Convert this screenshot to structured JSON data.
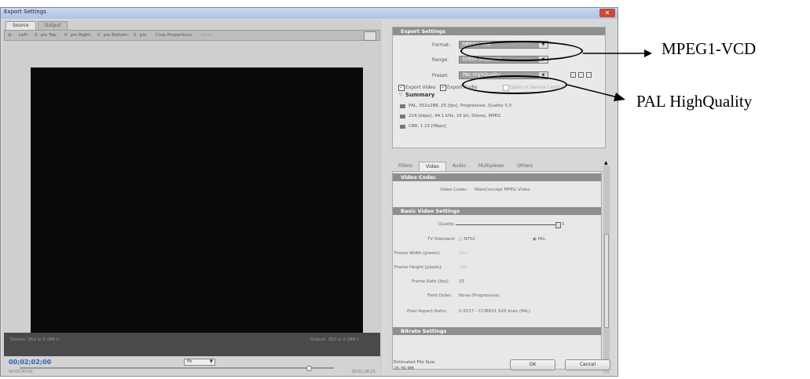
{
  "window": {
    "title": "Export Settings",
    "close_glyph": "✕"
  },
  "left": {
    "tabs": [
      "Source",
      "Output"
    ],
    "crop": {
      "left": "Left:",
      "top": "pix Top:",
      "right": "pix Right:",
      "bottom": "pix Bottom:",
      "pix": "pix",
      "proportions": "Crop Proportions:",
      "proportions_value": "None"
    },
    "source_info": "Source: 352 w X 288 h",
    "output_info": "Output: 352 w X 288 h",
    "timecode": "00;02;02;00",
    "fit": "Fit",
    "time_start": "00;00;00;00",
    "time_end": "00;02;28;21",
    "playhead_fraction": 0.92
  },
  "export": {
    "header": "Export Settings",
    "format_label": "Format:",
    "format_value": "MPEG1-VCD",
    "range_label": "Range:",
    "range_value": "Entire Sequence",
    "preset_label": "Preset:",
    "preset_value": "PAL HighQuality",
    "export_video": "Export Video",
    "export_audio": "Export Audio",
    "open_in_device": "Open in Device Central",
    "summary_title": "Summary",
    "summary_video": "PAL, 352x288, 25 [fps], Progressive, Quality 5.0",
    "summary_audio": "224 [kbps], 44.1 kHz, 16 bit, Stereo, MPEG",
    "summary_bitrate": "CBR, 1.15 [Mbps]"
  },
  "tabs2": [
    "Filters",
    "Video",
    "Audio",
    "Multiplexer",
    "Others"
  ],
  "video": {
    "codec_header": "Video Codec",
    "codec_label": "Video Codec:",
    "codec_value": "MainConcept MPEG Video",
    "basic_header": "Basic Video Settings",
    "quality_label": "Quality:",
    "quality_value": "5",
    "quality_fraction": 1.0,
    "tv_label": "TV Standard:",
    "ntsc": "NTSC",
    "pal": "PAL",
    "fw_label": "Frame Width [pixels]:",
    "fw_value": "352",
    "fh_label": "Frame Height [pixels]:",
    "fh_value": "288",
    "fr_label": "Frame Rate [fps]:",
    "fr_value": "25",
    "fo_label": "Field Order:",
    "fo_value": "None (Progressive)",
    "par_label": "Pixel Aspect Ratio:",
    "par_value": "0.9157 - CCIR601 625 lines (PAL)",
    "bitrate_header": "Bitrate Settings"
  },
  "footer": {
    "est_label": "Estimated File Size:",
    "est_value": "26.36 MB",
    "ok": "OK",
    "cancel": "Cancel"
  },
  "callouts": {
    "format": "MPEG1-VCD",
    "preset": "PAL HighQuality"
  }
}
